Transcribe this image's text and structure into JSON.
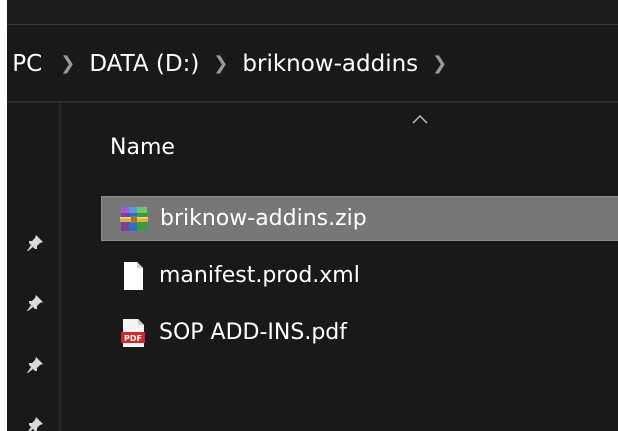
{
  "breadcrumb": {
    "items": [
      "s PC",
      "DATA (D:)",
      "briknow-addins"
    ]
  },
  "file_list": {
    "column_header": "Name",
    "files": [
      {
        "name": "briknow-addins.zip",
        "icon": "winrar-archive-icon",
        "selected": true
      },
      {
        "name": "manifest.prod.xml",
        "icon": "blank-file-icon",
        "selected": false
      },
      {
        "name": "SOP ADD-INS.pdf",
        "icon": "pdf-file-icon",
        "selected": false
      }
    ]
  },
  "nav_pane": {
    "pinned_items": 4
  },
  "colors": {
    "background": "#191919",
    "selection": "#777777",
    "text": "#ffffff",
    "pdf_red": "#d0282a"
  }
}
